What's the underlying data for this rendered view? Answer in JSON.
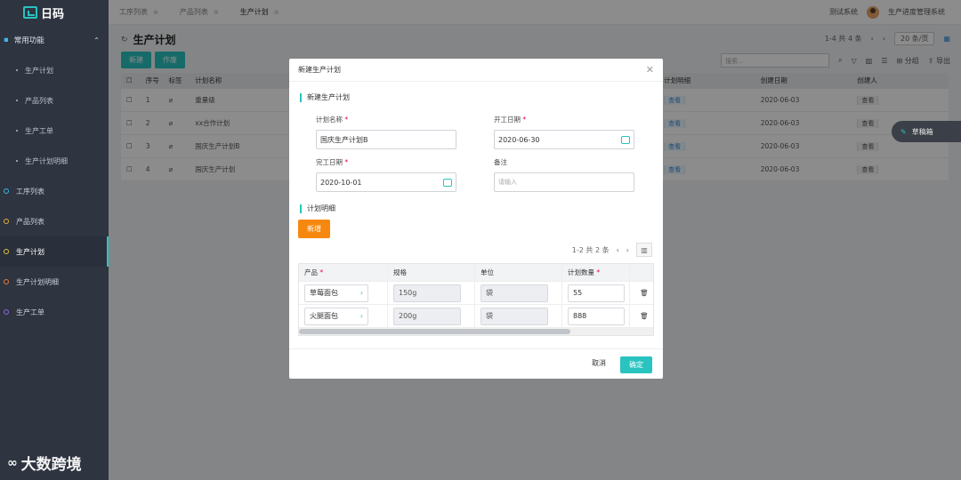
{
  "app": {
    "logo_text": "日码"
  },
  "sidebar": {
    "group_label": "常用功能",
    "group_items": [
      "生产计划",
      "产品列表",
      "生产工单",
      "生产计划明细"
    ],
    "items": [
      "工序列表",
      "产品列表",
      "生产计划",
      "生产计划明细",
      "生产工单"
    ]
  },
  "tabs": [
    "工序列表",
    "产品列表",
    "生产计划"
  ],
  "topbar": {
    "system": "测试系统",
    "user": "生产进度管理系统"
  },
  "page": {
    "title": "生产计划",
    "new_label": "新建",
    "void_label": "作废",
    "pager_text": "1-4 共 4 条",
    "page_size": "20 条/页",
    "search_placeholder": "搜索...",
    "group_label": "分组",
    "export_label": "导出"
  },
  "table": {
    "headers": [
      "序号",
      "标签",
      "计划名称",
      "计划明细",
      "创建日期",
      "创建人"
    ],
    "rows": [
      {
        "no": "1",
        "name": "重量级",
        "detail": "查看",
        "date": "2020-06-03",
        "creator": "查看"
      },
      {
        "no": "2",
        "name": "xx合作计划",
        "detail": "查看",
        "date": "2020-06-03",
        "creator": "查看"
      },
      {
        "no": "3",
        "name": "国庆生产计划B",
        "detail": "查看",
        "date": "2020-06-03",
        "creator": "查看"
      },
      {
        "no": "4",
        "name": "国庆生产计划",
        "detail": "查看",
        "date": "2020-06-03",
        "creator": "查看"
      }
    ]
  },
  "draft_box": "草稿箱",
  "modal": {
    "title": "新建生产计划",
    "section1": "新建生产计划",
    "plan_name_label": "计划名称",
    "plan_name_value": "国庆生产计划B",
    "start_label": "开工日期",
    "start_value": "2020-06-30",
    "end_label": "完工日期",
    "end_value": "2020-10-01",
    "note_label": "备注",
    "note_placeholder": "请输入",
    "section2": "计划明细",
    "add_label": "新增",
    "sub_pager": "1-2 共 2 条",
    "sub_headers": [
      "产品",
      "规格",
      "单位",
      "计划数量"
    ],
    "sub_rows": [
      {
        "product": "草莓面包",
        "spec": "150g",
        "unit": "袋",
        "qty": "55"
      },
      {
        "product": "火腿面包",
        "spec": "200g",
        "unit": "袋",
        "qty": "888"
      }
    ],
    "cancel_label": "取消",
    "ok_label": "确定"
  },
  "watermark": "大数跨境"
}
